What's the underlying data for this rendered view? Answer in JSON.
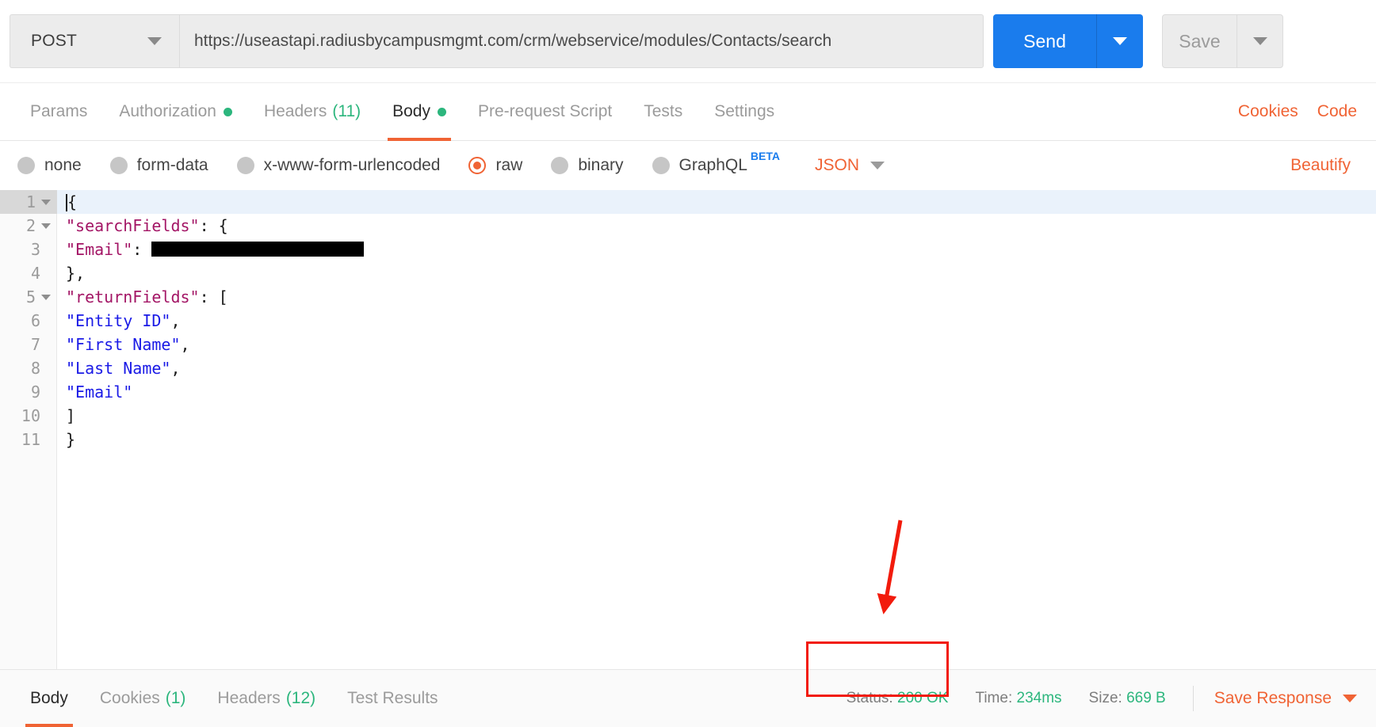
{
  "request_bar": {
    "method": "POST",
    "method_caret_icon": "chevron-down-icon",
    "url": "https://useastapi.radiusbycampusmgmt.com/crm/webservice/modules/Contacts/search",
    "url_placeholder": "Enter request URL",
    "send_label": "Send",
    "send_caret_icon": "chevron-down-icon",
    "save_label": "Save",
    "save_caret_icon": "chevron-down-icon"
  },
  "request_tabs": {
    "items": [
      {
        "label": "Params",
        "badge": "",
        "dot": false,
        "active": false
      },
      {
        "label": "Authorization",
        "badge": "",
        "dot": true,
        "active": false
      },
      {
        "label": "Headers",
        "badge": "(11)",
        "dot": false,
        "active": false
      },
      {
        "label": "Body",
        "badge": "",
        "dot": true,
        "active": true
      },
      {
        "label": "Pre-request Script",
        "badge": "",
        "dot": false,
        "active": false
      },
      {
        "label": "Tests",
        "badge": "",
        "dot": false,
        "active": false
      },
      {
        "label": "Settings",
        "badge": "",
        "dot": false,
        "active": false
      }
    ],
    "cookies_link": "Cookies",
    "code_link": "Code"
  },
  "body_types": {
    "options": [
      {
        "label": "none",
        "selected": false
      },
      {
        "label": "form-data",
        "selected": false
      },
      {
        "label": "x-www-form-urlencoded",
        "selected": false
      },
      {
        "label": "raw",
        "selected": true
      },
      {
        "label": "binary",
        "selected": false
      },
      {
        "label": "GraphQL",
        "selected": false,
        "sup": "BETA"
      }
    ],
    "language": "JSON",
    "language_caret_icon": "chevron-down-icon",
    "beautify_label": "Beautify"
  },
  "editor": {
    "lines": [
      {
        "num": "1",
        "fold": true,
        "current": true,
        "segments": [
          {
            "t": "pun",
            "v": "{"
          }
        ]
      },
      {
        "num": "2",
        "fold": true,
        "current": false,
        "segments": [
          {
            "t": "key",
            "v": "\"searchFields\""
          },
          {
            "t": "pun",
            "v": ": {"
          }
        ]
      },
      {
        "num": "3",
        "fold": false,
        "current": false,
        "segments": [
          {
            "t": "key",
            "v": "\"Email\""
          },
          {
            "t": "pun",
            "v": ": "
          },
          {
            "t": "redacted",
            "v": ""
          }
        ]
      },
      {
        "num": "4",
        "fold": false,
        "current": false,
        "segments": [
          {
            "t": "pun",
            "v": "},"
          }
        ]
      },
      {
        "num": "5",
        "fold": true,
        "current": false,
        "segments": [
          {
            "t": "key",
            "v": "\"returnFields\""
          },
          {
            "t": "pun",
            "v": ": ["
          }
        ]
      },
      {
        "num": "6",
        "fold": false,
        "current": false,
        "segments": [
          {
            "t": "str",
            "v": "\"Entity ID\""
          },
          {
            "t": "pun",
            "v": ","
          }
        ]
      },
      {
        "num": "7",
        "fold": false,
        "current": false,
        "segments": [
          {
            "t": "str",
            "v": "\"First Name\""
          },
          {
            "t": "pun",
            "v": ","
          }
        ]
      },
      {
        "num": "8",
        "fold": false,
        "current": false,
        "segments": [
          {
            "t": "str",
            "v": "\"Last Name\""
          },
          {
            "t": "pun",
            "v": ","
          }
        ]
      },
      {
        "num": "9",
        "fold": false,
        "current": false,
        "segments": [
          {
            "t": "str",
            "v": "\"Email\""
          }
        ]
      },
      {
        "num": "10",
        "fold": false,
        "current": false,
        "segments": [
          {
            "t": "pun",
            "v": "]"
          }
        ]
      },
      {
        "num": "11",
        "fold": false,
        "current": false,
        "segments": [
          {
            "t": "pun",
            "v": "}"
          }
        ]
      }
    ]
  },
  "response_bar": {
    "tabs": [
      {
        "label": "Body",
        "badge": "",
        "active": true
      },
      {
        "label": "Cookies",
        "badge": "(1)",
        "active": false
      },
      {
        "label": "Headers",
        "badge": "(12)",
        "active": false
      },
      {
        "label": "Test Results",
        "badge": "",
        "active": false
      }
    ],
    "status_label": "Status:",
    "status_value": "200 OK",
    "time_label": "Time:",
    "time_value": "234ms",
    "size_label": "Size:",
    "size_value": "669 B",
    "save_response_label": "Save Response",
    "save_response_caret_icon": "chevron-down-icon"
  },
  "annotations": {
    "arrow_color": "#f21b0c",
    "highlight_color": "#f21b0c"
  },
  "colors": {
    "accent_orange": "#f06334",
    "send_blue": "#1a7ced",
    "success_green": "#2cb67d",
    "annotation_red": "#f21b0c"
  }
}
